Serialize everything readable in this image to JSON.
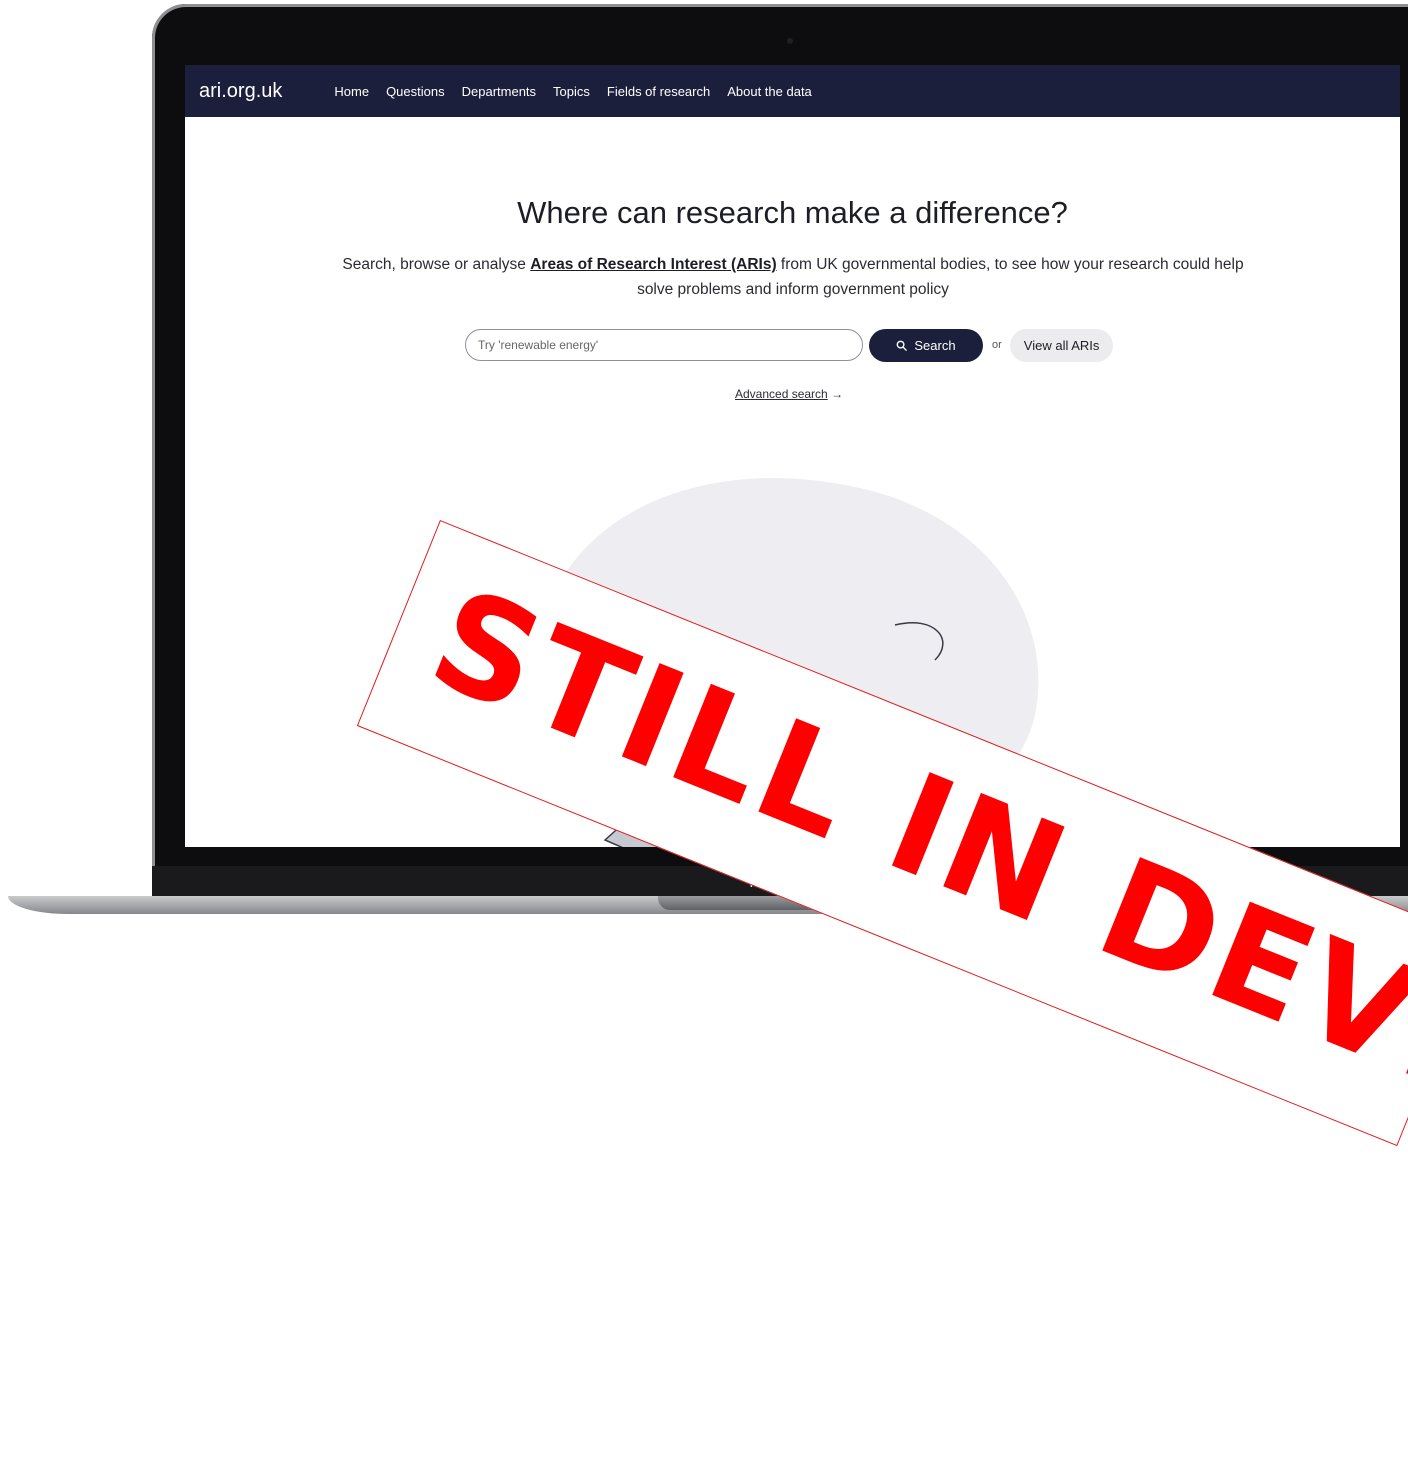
{
  "device": {
    "label": "MacBook Air"
  },
  "site": {
    "brand": "ari.org.uk",
    "nav": [
      "Home",
      "Questions",
      "Departments",
      "Topics",
      "Fields of research",
      "About the data"
    ]
  },
  "hero": {
    "title": "Where can research make a difference?",
    "subtitle_pre": "Search, browse or analyse ",
    "subtitle_link": "Areas of Research Interest (ARIs)",
    "subtitle_post": " from UK governmental bodies, to see how your research could help solve problems and inform government policy"
  },
  "search": {
    "placeholder": "Try 'renewable energy'",
    "button_label": "Search",
    "or_text": "or",
    "view_all_label": "View all ARIs",
    "advanced_label": "Advanced search",
    "advanced_arrow": "→"
  },
  "banner": {
    "text": "STILL IN DEVELOPMENT"
  },
  "colors": {
    "navbar": "#1b1f3b",
    "banner_text": "#ff0000",
    "banner_border": "#e21b1b"
  },
  "icons": {
    "search_button": "magnifier-icon",
    "camera": "camera-icon"
  }
}
